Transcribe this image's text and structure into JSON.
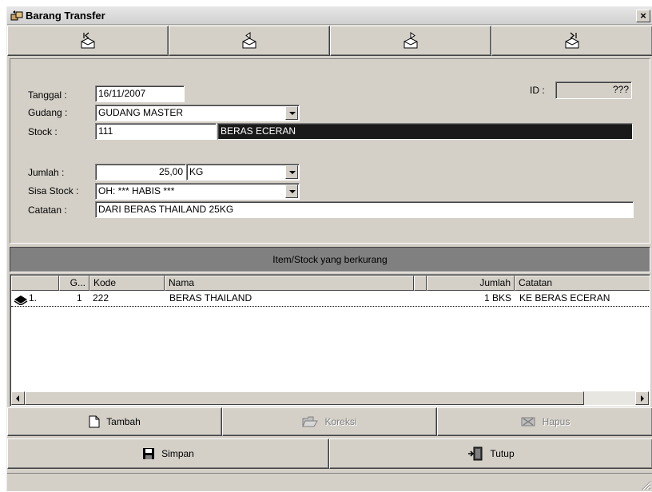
{
  "window": {
    "title": "Barang Transfer",
    "close_label": "×"
  },
  "nav": [
    "first-record",
    "previous-record",
    "next-record",
    "last-record"
  ],
  "form": {
    "tanggal_label": "Tanggal :",
    "tanggal_value": "16/11/2007",
    "id_label": "ID :",
    "id_value": "???",
    "gudang_label": "Gudang :",
    "gudang_value": "GUDANG MASTER",
    "stock_label": "Stock :",
    "stock_code": "111",
    "stock_name": "BERAS ECERAN",
    "jumlah_label": "Jumlah :",
    "jumlah_value": "25,00",
    "unit_value": "KG",
    "sisa_label": "Sisa Stock :",
    "sisa_value": "OH: *** HABIS ***",
    "catatan_label": "Catatan :",
    "catatan_value": "DARI BERAS THAILAND 25KG"
  },
  "section_title": "Item/Stock yang berkurang",
  "grid": {
    "headers": [
      "G...",
      "Kode",
      "Nama",
      "Jumlah",
      "Catatan"
    ],
    "rows": [
      {
        "no": "1.",
        "g": "1",
        "kode": "222",
        "nama": "BERAS THAILAND",
        "jumlah": "1 BKS",
        "catatan": "KE BERAS ECERAN"
      }
    ]
  },
  "actions": {
    "tambah": "Tambah",
    "koreksi": "Koreksi",
    "hapus": "Hapus",
    "simpan": "Simpan",
    "tutup": "Tutup"
  },
  "colors": {
    "face": "#d4d0c8",
    "section_bar": "#808080",
    "stock_name_bg": "#1a1a1a"
  },
  "icons": [
    "transfer-app-icon",
    "first-record-icon",
    "previous-record-icon",
    "next-record-icon",
    "last-record-icon",
    "row-book-icon",
    "new-document-icon",
    "open-folder-icon",
    "delete-icon",
    "floppy-disk-icon",
    "exit-door-icon"
  ]
}
